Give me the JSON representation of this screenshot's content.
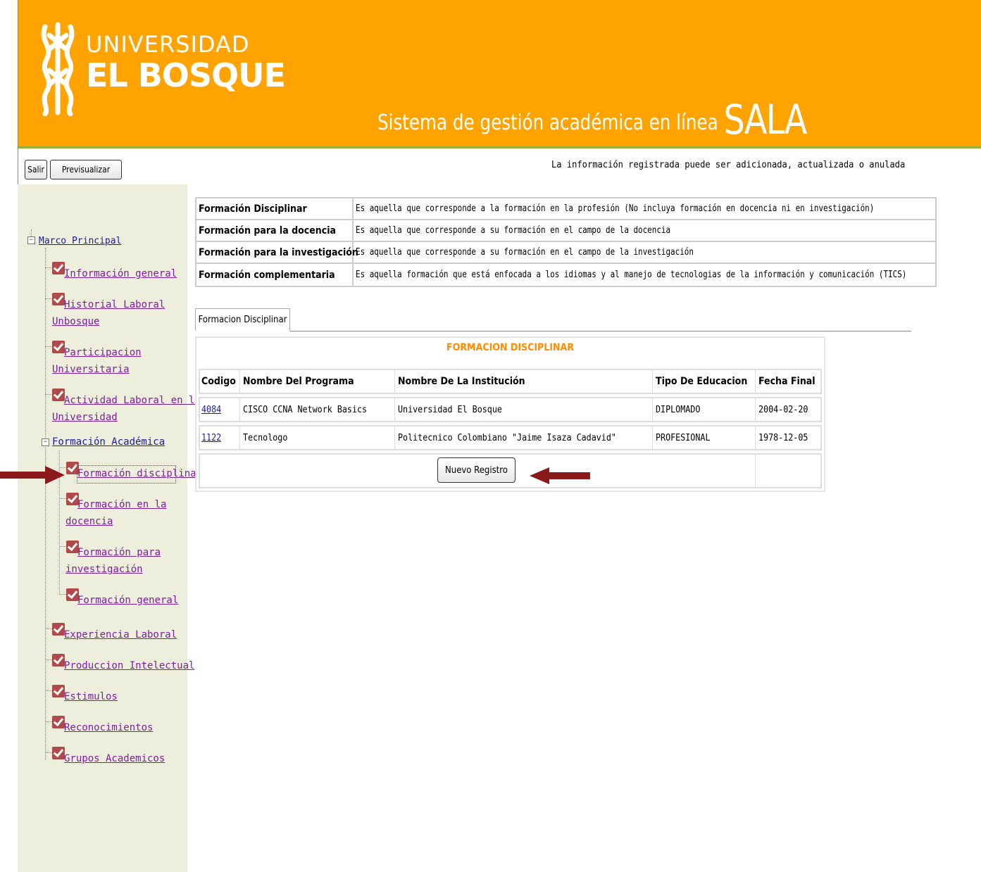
{
  "header": {
    "logo_top": "UNIVERSIDAD",
    "logo_bottom": "EL BOSQUE",
    "system_title": "Sistema de gestión académica en línea",
    "system_name": "SALA"
  },
  "toolbar": {
    "exit_label": "Salir",
    "preview_label": "Previsualizar",
    "notice": "La información registrada puede ser adicionada, actualizada o anulada"
  },
  "sidebar": {
    "root_label": "Marco Principal",
    "items": [
      {
        "label_1": "Información general",
        "label_2": ""
      },
      {
        "label_1": "Historial Laboral",
        "label_2": "Unbosque"
      },
      {
        "label_1": "Participacion",
        "label_2": "Universitaria"
      },
      {
        "label_1": "Actividad Laboral en la",
        "label_2": "Universidad"
      }
    ],
    "group_label": "Formación Académica",
    "sub_items": [
      {
        "label_1": "Formación disciplinar",
        "label_2": ""
      },
      {
        "label_1": "Formación en la",
        "label_2": "docencia"
      },
      {
        "label_1": "Formación para",
        "label_2": "investigación"
      },
      {
        "label_1": "Formación general",
        "label_2": ""
      }
    ],
    "bottom_items": [
      {
        "label": "Experiencia Laboral"
      },
      {
        "label": "Produccion Intelectual"
      },
      {
        "label": "Estimulos"
      },
      {
        "label": "Reconocimientos"
      },
      {
        "label": "Grupos Academicos"
      }
    ]
  },
  "definitions": [
    {
      "term": "Formación Disciplinar",
      "description": "Es aquella que corresponde a la formación en la profesión (No incluya formación en docencia ni en investigación)"
    },
    {
      "term": "Formación para la docencia",
      "description": "Es aquella que corresponde a su formación en el campo de la docencia"
    },
    {
      "term": "Formación para la investigación",
      "description": "Es aquella que corresponde a su formación en el campo de la investigación"
    },
    {
      "term": "Formación complementaria",
      "description": "Es aquella formación que está enfocada a los idiomas y al manejo de tecnologias de la información y comunicación (TICS)"
    }
  ],
  "tab": {
    "label": "Formacion Disciplinar"
  },
  "panel": {
    "title": "FORMACION DISCIPLINAR",
    "columns": [
      "Codigo",
      "Nombre Del Programa",
      "Nombre De La Institución",
      "Tipo De Educacion",
      "Fecha Final"
    ],
    "rows": [
      {
        "codigo": "4084",
        "programa": "CISCO CCNA Network Basics",
        "institucion": "Universidad El Bosque",
        "tipo": "DIPLOMADO",
        "fecha": "2004-02-20"
      },
      {
        "codigo": "1122",
        "programa": "Tecnologo",
        "institucion": "Politecnico Colombiano \"Jaime Isaza Cadavid\"",
        "tipo": "PROFESIONAL",
        "fecha": "1978-12-05"
      }
    ],
    "new_button": "Nuevo Registro"
  },
  "colors": {
    "header_orange": "#ffa300",
    "header_border": "#8db53c",
    "sidebar_bg": "#eeeedc",
    "checkbox": "#b04a4a",
    "arrow": "#8b1a1a",
    "panel_title": "#ff8c00",
    "link_visited": "#7b1fa2",
    "link": "#1a1aa6"
  }
}
